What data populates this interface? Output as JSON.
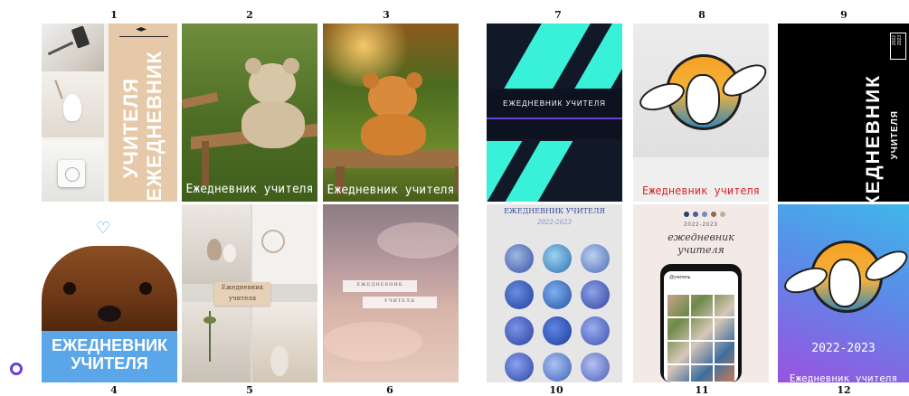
{
  "numbers": [
    "1",
    "2",
    "3",
    "4",
    "5",
    "6",
    "7",
    "8",
    "9",
    "10",
    "11",
    "12"
  ],
  "covers": {
    "c1": {
      "title_line1": "ЕЖЕДНЕВНИК",
      "title_line2": "УЧИТЕЛЯ"
    },
    "c2": {
      "title": "Ежедневник учителя"
    },
    "c3": {
      "title": "Ежедневник учителя"
    },
    "c4": {
      "title_line1": "ЕЖЕДНЕВНИК",
      "title_line2": "УЧИТЕЛЯ"
    },
    "c5": {
      "title_line1": "Ежедневник",
      "title_line2": "учителя"
    },
    "c6": {
      "title_line1": "ЕЖЕДНЕВНИК",
      "title_line2": "УЧИТЕЛЯ"
    },
    "c7": {
      "title": "ЕЖЕДНЕВНИК УЧИТЕЛЯ"
    },
    "c8": {
      "title": "Ежедневник учителя"
    },
    "c9": {
      "title": "ЕЖЕДНЕВНИК",
      "subtitle": "УЧИТЕЛЯ",
      "badge_line1": "2022",
      "badge_line2": "2023"
    },
    "c10": {
      "title": "ЕЖЕДНЕВНИК УЧИТЕЛЯ",
      "year": "2022-2023"
    },
    "c11": {
      "year": "2022-2023",
      "script_line1": "ежедневник",
      "script_line2": "учителя",
      "phone_header": "@учитель"
    },
    "c12": {
      "year": "2022-2023",
      "title": "Ежедневник учителя"
    }
  },
  "colors": {
    "teal": "#39f0d8",
    "navy": "#111827",
    "blue_band": "#5aa6e8",
    "beige": "#e5c9a8"
  }
}
